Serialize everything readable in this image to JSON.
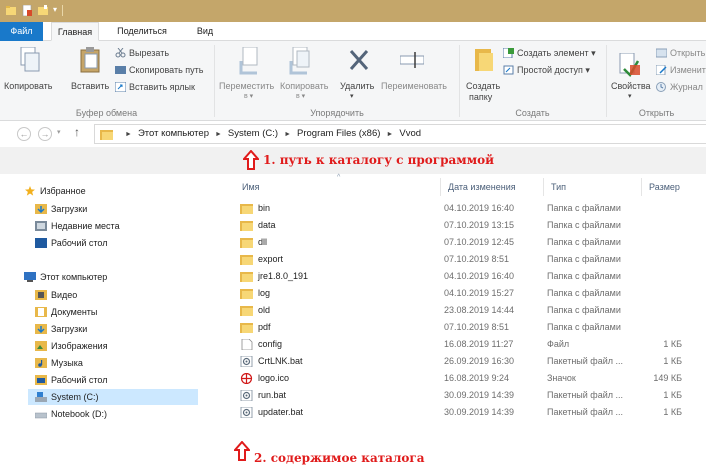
{
  "ribbon": {
    "tabs": [
      "Файл",
      "Главная",
      "Поделиться",
      "Вид"
    ],
    "clipboard": {
      "copy": "Копировать",
      "paste": "Вставить",
      "cut": "Вырезать",
      "copy_path": "Скопировать путь",
      "paste_shortcut": "Вставить ярлык",
      "group_label": "Буфер обмена"
    },
    "organize": {
      "move_to": "Переместить",
      "copy_to": "Копировать",
      "move_to_sub": "в ▾",
      "copy_to_sub": "в ▾",
      "delete": "Удалить",
      "rename": "Переименовать",
      "group_label": "Упорядочить"
    },
    "new": {
      "new_folder_1": "Создать",
      "new_folder_2": "папку",
      "new_item": "Создать элемент ▾",
      "easy_access": "Простой доступ ▾",
      "group_label": "Создать"
    },
    "open": {
      "properties": "Свойства",
      "open": "Открыть",
      "edit": "Изменить",
      "history": "Журнал",
      "group_label": "Открыть"
    }
  },
  "address": {
    "back": "←",
    "forward": "→",
    "up": "↑",
    "crumbs": [
      "Этот компьютер",
      "System (C:)",
      "Program Files (x86)",
      "Vvod"
    ]
  },
  "annotations": {
    "path": "1. путь к каталогу с программой",
    "contents": "2. содержимое каталога"
  },
  "nav": {
    "favorites": "Избранное",
    "favorites_items": [
      "Загрузки",
      "Недавние места",
      "Рабочий стол"
    ],
    "this_pc": "Этот компьютер",
    "pc_items": [
      "Видео",
      "Документы",
      "Загрузки",
      "Изображения",
      "Музыка",
      "Рабочий стол",
      "System (C:)",
      "Notebook (D:)"
    ]
  },
  "columns": {
    "name": "Имя",
    "date": "Дата изменения",
    "type": "Тип",
    "size": "Размер"
  },
  "files": [
    {
      "name": "bin",
      "date": "04.10.2019 16:40",
      "type": "Папка с файлами",
      "size": "",
      "icon": "folder"
    },
    {
      "name": "data",
      "date": "07.10.2019 13:15",
      "type": "Папка с файлами",
      "size": "",
      "icon": "folder"
    },
    {
      "name": "dll",
      "date": "07.10.2019 12:45",
      "type": "Папка с файлами",
      "size": "",
      "icon": "folder"
    },
    {
      "name": "export",
      "date": "07.10.2019 8:51",
      "type": "Папка с файлами",
      "size": "",
      "icon": "folder"
    },
    {
      "name": "jre1.8.0_191",
      "date": "04.10.2019 16:40",
      "type": "Папка с файлами",
      "size": "",
      "icon": "folder"
    },
    {
      "name": "log",
      "date": "04.10.2019 15:27",
      "type": "Папка с файлами",
      "size": "",
      "icon": "folder"
    },
    {
      "name": "old",
      "date": "23.08.2019 14:44",
      "type": "Папка с файлами",
      "size": "",
      "icon": "folder"
    },
    {
      "name": "pdf",
      "date": "07.10.2019 8:51",
      "type": "Папка с файлами",
      "size": "",
      "icon": "folder"
    },
    {
      "name": "config",
      "date": "16.08.2019 11:27",
      "type": "Файл",
      "size": "1 КБ",
      "icon": "file"
    },
    {
      "name": "CrtLNK.bat",
      "date": "26.09.2019 16:30",
      "type": "Пакетный файл ...",
      "size": "1 КБ",
      "icon": "bat"
    },
    {
      "name": "logo.ico",
      "date": "16.08.2019 9:24",
      "type": "Значок",
      "size": "149 КБ",
      "icon": "ico"
    },
    {
      "name": "run.bat",
      "date": "30.09.2019 14:39",
      "type": "Пакетный файл ...",
      "size": "1 КБ",
      "icon": "bat"
    },
    {
      "name": "updater.bat",
      "date": "30.09.2019 14:39",
      "type": "Пакетный файл ...",
      "size": "1 КБ",
      "icon": "bat"
    }
  ]
}
